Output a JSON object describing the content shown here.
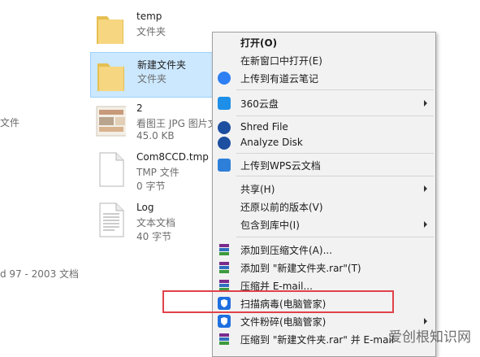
{
  "left_fragments": [
    "文件",
    "d 97 - 2003 文档"
  ],
  "files": [
    {
      "name": "temp",
      "type": "文件夹",
      "size": "",
      "icon": "folder-icon"
    },
    {
      "name": "新建文件夹",
      "type": "文件夹",
      "size": "",
      "icon": "folder-icon",
      "selected": true
    },
    {
      "name": "2",
      "type": "看图王 JPG 图片文",
      "size": "45.0 KB",
      "icon": "image-thumbnail-icon"
    },
    {
      "name": "Com8CCD.tmp",
      "type": "TMP 文件",
      "size": "0 字节",
      "icon": "blank-file-icon"
    },
    {
      "name": "Log",
      "type": "文本文档",
      "size": "40 字节",
      "icon": "text-file-icon"
    }
  ],
  "context_menu": {
    "items": [
      {
        "label": "打开(O)",
        "bold": true,
        "icon": "",
        "submenu": false
      },
      {
        "label": "在新窗口中打开(E)",
        "icon": "",
        "submenu": false
      },
      {
        "label": "上传到有道云笔记",
        "icon": "youdao-note-icon",
        "submenu": false
      },
      {
        "label": "360云盘",
        "icon": "360-cloud-icon",
        "submenu": true
      },
      {
        "label": "Shred File",
        "icon": "shred-icon",
        "submenu": false
      },
      {
        "label": "Analyze Disk",
        "icon": "analyze-disk-icon",
        "submenu": false
      },
      {
        "label": "上传到WPS云文档",
        "icon": "wps-cloud-icon",
        "submenu": false
      },
      {
        "label": "共享(H)",
        "icon": "",
        "submenu": true
      },
      {
        "label": "还原以前的版本(V)",
        "icon": "",
        "submenu": false
      },
      {
        "label": "包含到库中(I)",
        "icon": "",
        "submenu": true
      },
      {
        "label": "添加到压缩文件(A)...",
        "icon": "winrar-icon",
        "submenu": false
      },
      {
        "label": "添加到 \"新建文件夹.rar\"(T)",
        "icon": "winrar-icon",
        "submenu": false
      },
      {
        "label": "压缩并 E-mail...",
        "icon": "winrar-icon",
        "submenu": false
      },
      {
        "label": "扫描病毒(电脑管家)",
        "icon": "tencent-shield-icon",
        "submenu": false
      },
      {
        "label": "文件粉碎(电脑管家)",
        "icon": "tencent-shield-icon",
        "submenu": true
      },
      {
        "label": "压缩到 \"新建文件夹.rar\" 并 E-mail",
        "icon": "winrar-icon",
        "submenu": false
      }
    ]
  },
  "watermark": "爱创根知识网",
  "colors": {
    "selection": "#cce8ff",
    "highlight_border": "#e0424a",
    "menu_bg": "#f2f2f2"
  }
}
